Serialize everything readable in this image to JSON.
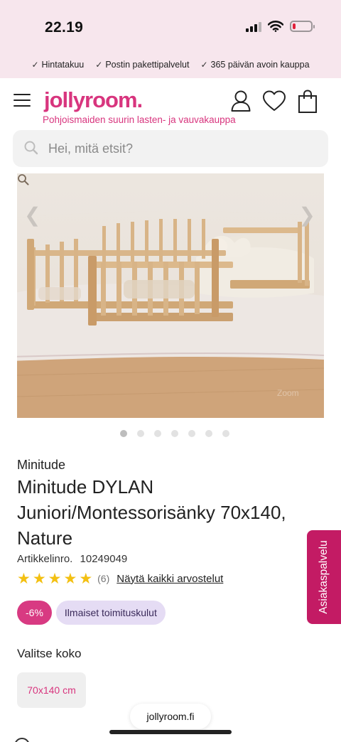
{
  "status_bar": {
    "time": "22.19",
    "icons": [
      "signal-icon",
      "wifi-icon",
      "battery-icon"
    ],
    "battery_level": 0.15,
    "battery_color": "#e0203a"
  },
  "usp": [
    {
      "icon": "check-icon",
      "label": "Hintatakuu"
    },
    {
      "icon": "check-icon",
      "label": "Postin pakettipalvelut"
    },
    {
      "icon": "check-icon",
      "label": "365 päivän avoin kauppa"
    }
  ],
  "header": {
    "logo": "jollyroom.",
    "tagline": "Pohjoismaiden suurin lasten- ja vauvakauppa",
    "brand_color": "#d8357e",
    "icons": [
      "menu-icon",
      "account-icon",
      "heart-icon",
      "bag-icon"
    ]
  },
  "search": {
    "placeholder": "Hei, mitä etsit?",
    "value": ""
  },
  "gallery": {
    "image_count": 7,
    "active_index": 0,
    "prev_icon": "chevron-left-icon",
    "next_icon": "chevron-right-icon",
    "zoom_icon": "zoom-icon",
    "zoom_label": "Zoom",
    "prev_glyph": "❮",
    "next_glyph": "❯"
  },
  "product": {
    "brand": "Minitude",
    "title": "Minitude DYLAN Juniori/Montessorisänky 70x140, Nature",
    "sku_label": "Artikkelinro.",
    "sku": "10249049",
    "rating": 5,
    "rating_count": "(6)",
    "reviews_link": "Näytä kaikki arvostelut",
    "discount_badge": "-6%",
    "delivery_badge": "Ilmaiset toimituskulut",
    "discount_color": "#d83a82",
    "delivery_color": "#e5dcf4",
    "star_color": "#f3c012"
  },
  "size": {
    "label": "Valitse koko",
    "options": [
      "70x140 cm"
    ],
    "selected": "70x140 cm"
  },
  "side_tab": {
    "label": "Asiakaspalvelu",
    "color": "#c31b64"
  },
  "browser": {
    "url": "jollyroom.fi"
  }
}
